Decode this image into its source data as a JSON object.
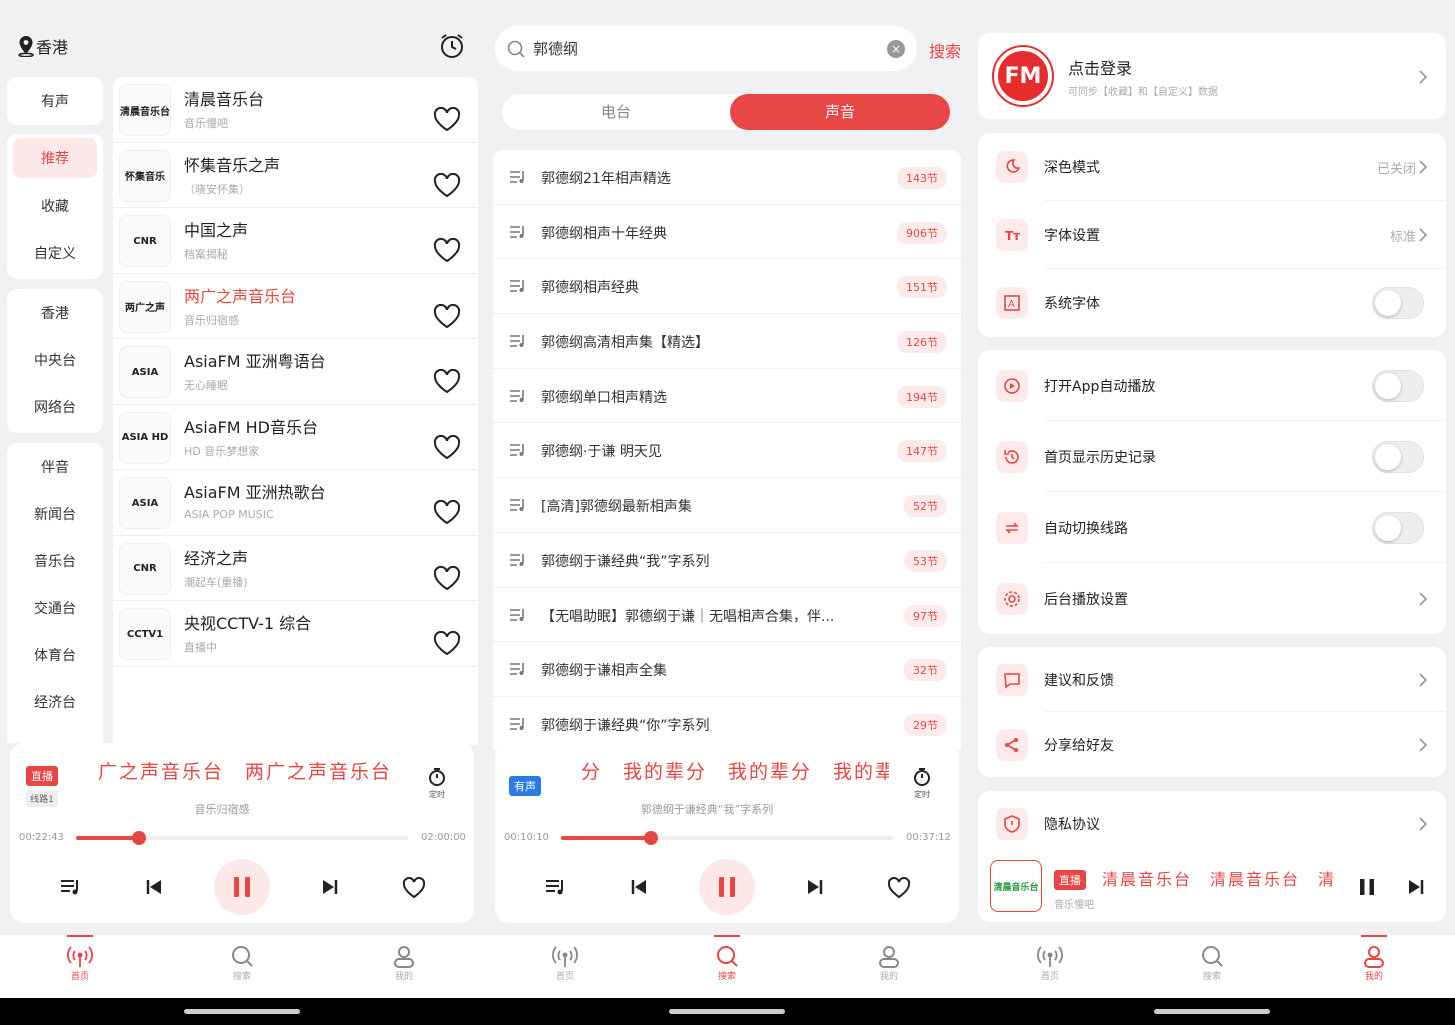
{
  "colors": {
    "accent": "#e84545",
    "blue_badge": "#2a7be4"
  },
  "home": {
    "location": "香港",
    "categories": [
      [
        "有声"
      ],
      [
        "推荐",
        "收藏",
        "自定义"
      ],
      [
        "香港",
        "中央台",
        "网络台"
      ],
      [
        "伴音",
        "新闻台",
        "音乐台",
        "交通台",
        "体育台",
        "经济台"
      ]
    ],
    "stations": [
      {
        "name": "清晨音乐台",
        "sub": "音乐慢吧",
        "logo": "清晨音乐台"
      },
      {
        "name": "怀集音乐之声",
        "sub": "（晓安怀集）",
        "logo": "怀集音乐"
      },
      {
        "name": "中国之声",
        "sub": "档案揭秘",
        "logo": "CNR"
      },
      {
        "name": "两广之声音乐台",
        "sub": "音乐归宿感",
        "logo": "两广之声"
      },
      {
        "name": "AsiaFM 亚洲粤语台",
        "sub": "无心睡眠",
        "logo": "ASIA"
      },
      {
        "name": "AsiaFM HD音乐台",
        "sub": "HD 音乐梦想家",
        "logo": "ASIA HD"
      },
      {
        "name": "AsiaFM 亚洲热歌台",
        "sub": "ASIA POP MUSIC",
        "logo": "ASIA"
      },
      {
        "name": "经济之声",
        "sub": "潮起车(重播)",
        "logo": "CNR"
      },
      {
        "name": "央视CCTV-1 综合",
        "sub": "直播中",
        "logo": "CCTV1"
      }
    ],
    "player": {
      "badge": "直播",
      "line": "线路1",
      "marquee": "广之声音乐台　两广之声音乐台",
      "subtitle": "音乐归宿感",
      "timer": "定时",
      "time_cur": "00:22:43",
      "time_total": "02:00:00",
      "progress": 0.19
    },
    "tabs": [
      "首页",
      "搜索",
      "我的"
    ]
  },
  "search": {
    "query": "郭德纲",
    "button": "搜索",
    "segments": [
      "电台",
      "声音"
    ],
    "results": [
      {
        "title": "郭德纲21年相声精选",
        "count": "143节"
      },
      {
        "title": "郭德纲相声十年经典",
        "count": "906节"
      },
      {
        "title": "郭德纲相声经典",
        "count": "151节"
      },
      {
        "title": "郭德纲高清相声集【精选】",
        "count": "126节"
      },
      {
        "title": "郭德纲单口相声精选",
        "count": "194节"
      },
      {
        "title": "郭德纲·于谦 明天见",
        "count": "147节"
      },
      {
        "title": "[高清]郭德纲最新相声集",
        "count": "52节"
      },
      {
        "title": "郭德纲于谦经典“我”字系列",
        "count": "53节"
      },
      {
        "title": "【无唱助眠】郭德纲于谦｜无唱相声合集，伴...",
        "count": "97节"
      },
      {
        "title": "郭德纲于谦相声全集",
        "count": "32节"
      },
      {
        "title": "郭德纲于谦经典“你”字系列",
        "count": "29节"
      }
    ],
    "player": {
      "badge": "有声",
      "marquee": "分　我的辈分　我的辈分　我的辈",
      "subtitle": "郭德纲于谦经典“我”字系列",
      "timer": "定时",
      "time_cur": "00:10:10",
      "time_total": "00:37:12",
      "progress": 0.27
    }
  },
  "mine": {
    "login_title": "点击登录",
    "login_sub": "可同步【收藏】和【自定义】数据",
    "fm": "FM",
    "groups": [
      [
        {
          "label": "深色模式",
          "value": "已关闭",
          "type": "chev",
          "icon": "moon-icon"
        },
        {
          "label": "字体设置",
          "value": "标准",
          "type": "chev",
          "icon": "font-icon"
        },
        {
          "label": "系统字体",
          "value": "",
          "type": "toggle",
          "icon": "system-font-icon"
        }
      ],
      [
        {
          "label": "打开App自动播放",
          "value": "",
          "type": "toggle",
          "icon": "play-circle-icon"
        },
        {
          "label": "首页显示历史记录",
          "value": "",
          "type": "toggle",
          "icon": "history-icon"
        },
        {
          "label": "自动切换线路",
          "value": "",
          "type": "toggle",
          "icon": "switch-icon"
        },
        {
          "label": "后台播放设置",
          "value": "",
          "type": "chev",
          "icon": "gear-icon"
        }
      ],
      [
        {
          "label": "建议和反馈",
          "value": "",
          "type": "chev",
          "icon": "feedback-icon"
        },
        {
          "label": "分享给好友",
          "value": "",
          "type": "chev",
          "icon": "share-icon"
        }
      ],
      [
        {
          "label": "隐私协议",
          "value": "",
          "type": "chev",
          "icon": "shield-icon"
        }
      ]
    ],
    "mini": {
      "badge": "直播",
      "marquee": "清晨音乐台　清晨音乐台　清晨",
      "subtitle": "音乐慢吧",
      "logo": "清晨音乐台"
    }
  }
}
